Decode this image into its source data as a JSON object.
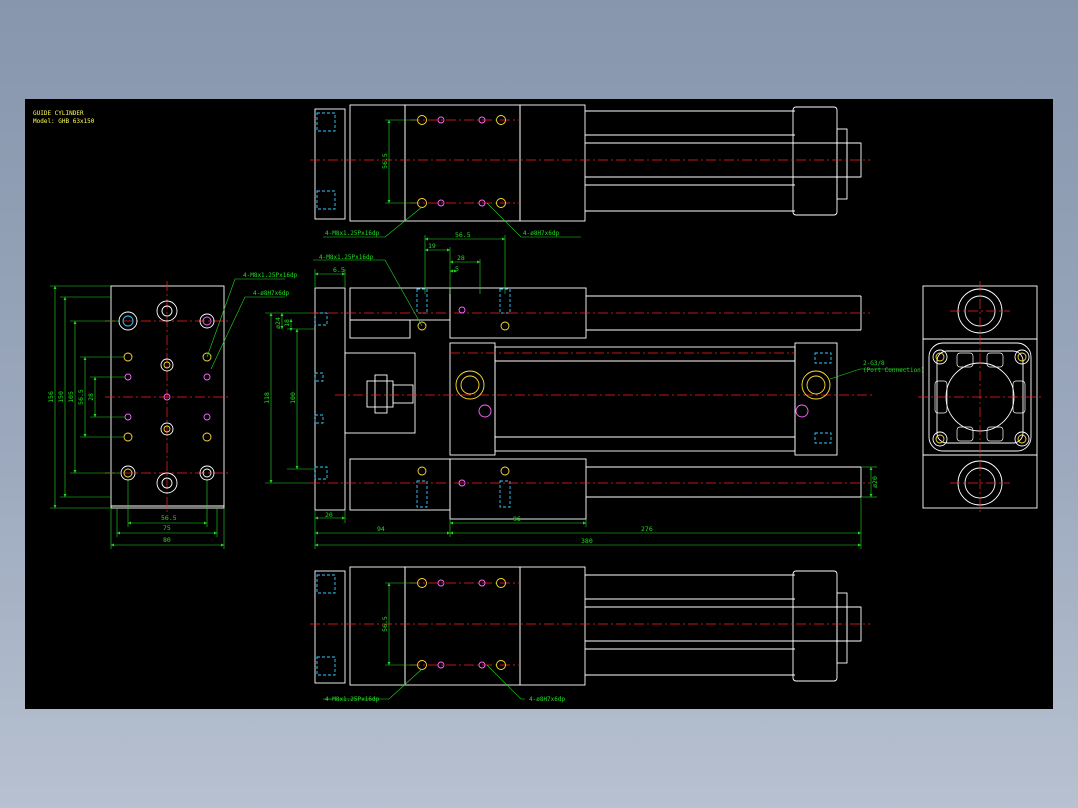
{
  "title_block": {
    "line1": "GUIDE CYLINDER",
    "line2": "Model: GHB 63x150"
  },
  "top_view": {
    "dim_pitch": "56.5",
    "note_left": "4-M8x1.25Px16dp",
    "note_right": "4-ø8H7x6dp"
  },
  "front_view": {
    "note_tap": "4-M8x1.25Px16dp",
    "dim_19": "19",
    "dim_56_5": "56.5",
    "dim_28": "28",
    "dim_5": "5",
    "dim_6_5": "6.5",
    "dim_24": "ø24",
    "dim_18": "18",
    "dim_118": "118",
    "dim_100": "100",
    "dim_20": "20",
    "dim_94": "94",
    "dim_96": "96",
    "dim_276": "276",
    "dim_380": "380",
    "dim_phi20": "ø20",
    "port_note": "2-G3/8",
    "port_sub": "(Port Connection)"
  },
  "side_view": {
    "note_tap": "4-M8x1.25Px16dp",
    "note_pin": "4-ø8H7x6dp",
    "dim_156": "156",
    "dim_150": "150",
    "dim_105": "105",
    "dim_56_5v": "56.5",
    "dim_28v": "28",
    "dim_56_5": "56.5",
    "dim_75": "75",
    "dim_80": "80"
  },
  "bottom_view": {
    "dim_pitch": "56.5",
    "note_left": "4-M8x1.25Px16dp",
    "note_right": "4-ø8H7x6dp"
  },
  "colors": {
    "outline": "#ffffff",
    "center": "#ff2222",
    "dimension": "#22dd22",
    "hidden": "#33ccff",
    "hole": "#ffdd33",
    "hatch": "#ff66ff"
  }
}
